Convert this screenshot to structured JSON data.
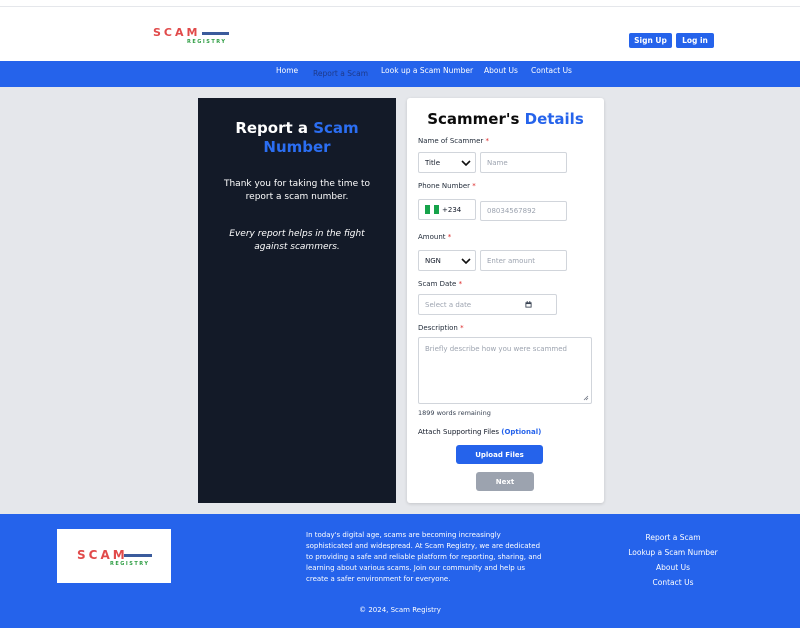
{
  "brand": {
    "logo_word": "SCAM",
    "logo_sub": "REGISTRY"
  },
  "header": {
    "signup_label": "Sign Up",
    "login_label": "Log in"
  },
  "nav": {
    "items": [
      {
        "label": "Home"
      },
      {
        "label": "Report a Scam"
      },
      {
        "label": "Look up a Scam Number"
      },
      {
        "label": "About Us"
      },
      {
        "label": "Contact Us"
      }
    ]
  },
  "left_panel": {
    "title_a": "Report a ",
    "title_b": "Scam",
    "title_c": "Number",
    "text1": "Thank you for taking the time to report a scam number.",
    "text2": "Every report helps in the fight against scammers."
  },
  "form": {
    "title_a": "Scammer's ",
    "title_b": "Details",
    "required_mark": "*",
    "name_label": "Name of Scammer",
    "title_select": "Title",
    "name_placeholder": "Name",
    "phone_label": "Phone Number",
    "phone_code": "+234",
    "phone_placeholder": "08034567892",
    "amount_label": "Amount",
    "currency": "NGN",
    "amount_placeholder": "Enter amount",
    "date_label": "Scam Date",
    "date_placeholder": "Select a date",
    "description_label": "Description",
    "description_placeholder": "Briefly describe how you were scammed",
    "words_remaining": "1899 words remaining",
    "attach_label": "Attach Supporting Files ",
    "attach_optional": "(Optional)",
    "upload_label": "Upload Files",
    "next_label": "Next"
  },
  "footer": {
    "about": "In today's digital age, scams are becoming increasingly sophisticated and widespread. At Scam Registry, we are dedicated to providing a safe and reliable platform for reporting, sharing, and learning about various scams. Join our community and help us create a safer environment for everyone.",
    "links": [
      {
        "label": "Report a Scam"
      },
      {
        "label": "Lookup a Scam Number"
      },
      {
        "label": "About Us"
      },
      {
        "label": "Contact Us"
      }
    ],
    "copyright": "© 2024, Scam Registry"
  },
  "colors": {
    "primary": "#2563eb",
    "dark_panel": "#131a28",
    "logo_red": "#e14a4a"
  }
}
